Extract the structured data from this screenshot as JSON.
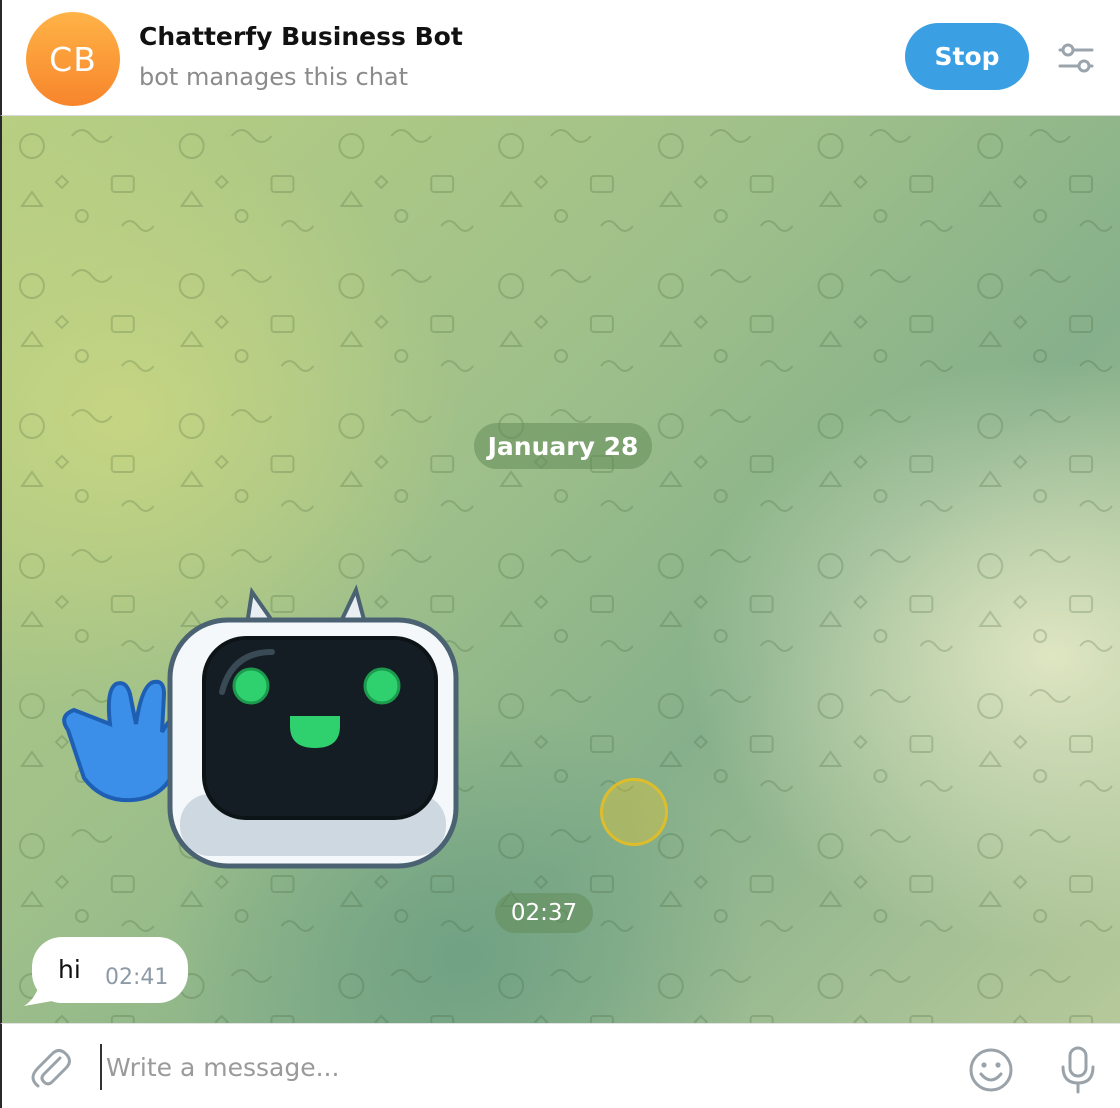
{
  "header": {
    "avatar_initials": "CB",
    "title": "Chatterfy Business Bot",
    "subtitle": "bot manages this chat",
    "stop_label": "Stop",
    "settings_icon": "sliders-icon"
  },
  "chat": {
    "date_separator": "January 28",
    "sticker": {
      "name": "waving-robot-sticker",
      "time": "02:37"
    },
    "messages": [
      {
        "text": "hi",
        "time": "02:41",
        "direction": "incoming"
      }
    ]
  },
  "composer": {
    "placeholder": "Write a message...",
    "value": "",
    "attach_icon": "paperclip-icon",
    "emoji_icon": "smile-icon",
    "mic_icon": "microphone-icon"
  },
  "colors": {
    "accent": "#3b9fe3",
    "avatar": "#f7852b",
    "chat_background": "#9fc08a"
  }
}
